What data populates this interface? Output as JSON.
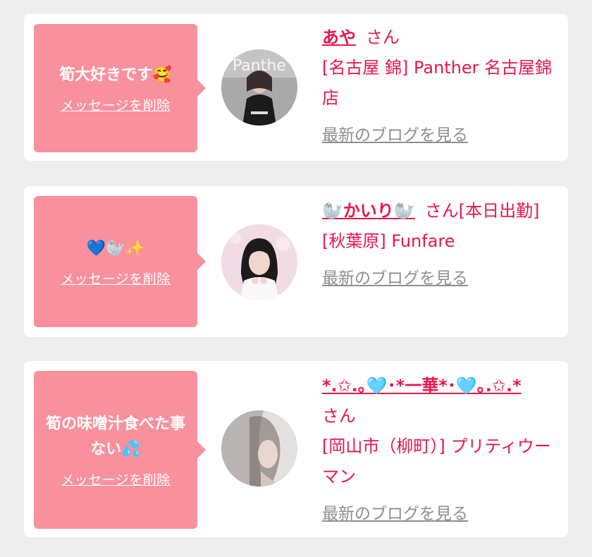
{
  "colors": {
    "accent": "#e8174c",
    "bubble": "#f9909d",
    "muted": "#8f8f8f"
  },
  "delete_label": "メッセージを削除",
  "blog_label": "最新のブログを見る",
  "san_label": "さん",
  "cards": [
    {
      "message": "筍大好きです🥰",
      "name": "あや",
      "suffix": "",
      "shop": "[名古屋 錦] Panther 名古屋錦店"
    },
    {
      "message": "💙🦭✨",
      "name": "🦭かいり🦭",
      "suffix": "[本日出勤]",
      "shop": "[秋葉原] Funfare"
    },
    {
      "message": "筍の味噌汁食べた事ない💦",
      "name": "*.✩.｡🩵･*一華*･🩵｡.✩.*",
      "suffix": "",
      "shop": "[岡山市（柳町）] プリティウーマン"
    }
  ]
}
